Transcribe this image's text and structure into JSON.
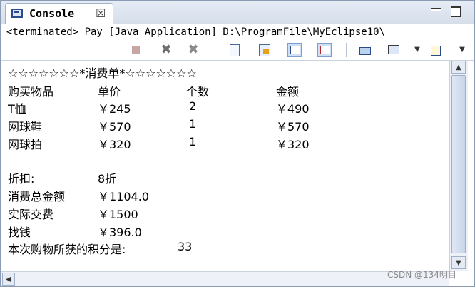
{
  "tab": {
    "title": "Console",
    "close": "☒"
  },
  "status": "<terminated> Pay [Java Application] D:\\ProgramFile\\MyEclipse10\\",
  "console": {
    "header_line": "☆☆☆☆☆☆☆*消费单*☆☆☆☆☆☆☆",
    "columns": [
      "购买物品",
      "单价",
      "个数",
      "金额"
    ],
    "rows": [
      [
        "T恤",
        "￥245",
        "2",
        "￥490"
      ],
      [
        "网球鞋",
        "￥570",
        "1",
        "￥570"
      ],
      [
        "网球拍",
        "￥320",
        "1",
        "￥320"
      ]
    ],
    "summary": [
      {
        "label": "折扣:",
        "value": "8折"
      },
      {
        "label": "消费总金额",
        "value": "￥1104.0"
      },
      {
        "label": "实际交费",
        "value": "￥1500"
      },
      {
        "label": "找钱",
        "value": "￥396.0"
      }
    ],
    "points_label": "本次购物所获的积分是:",
    "points_value": "33"
  },
  "toolbar": {
    "remove_launch": "✖",
    "remove_all": "✖",
    "dropdown": "▼"
  },
  "scroll": {
    "up": "▲",
    "down": "▼",
    "left": "◀"
  },
  "watermark": "CSDN @134明目"
}
